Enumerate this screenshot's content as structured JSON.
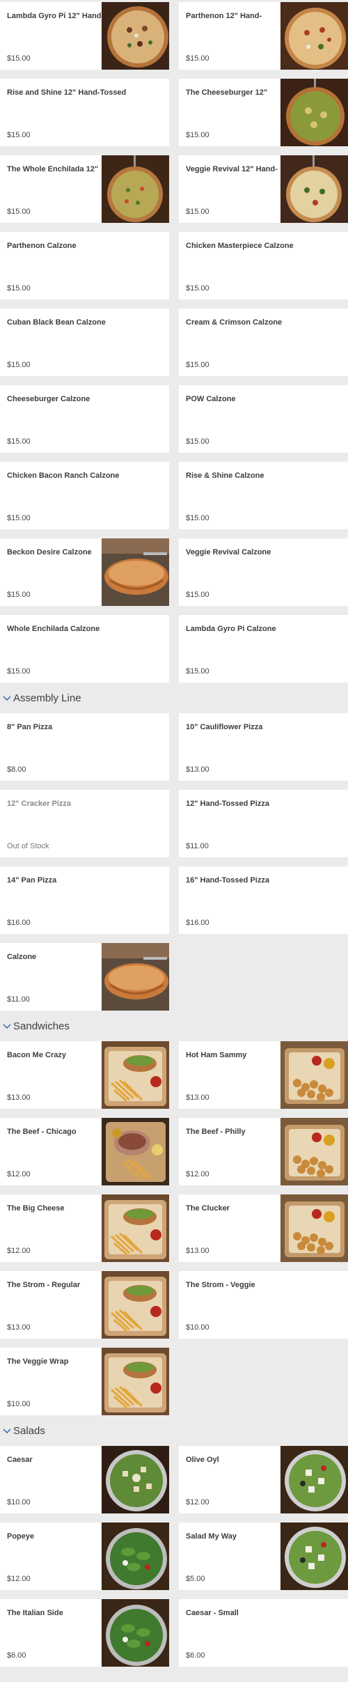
{
  "pizzas": [
    {
      "name": "Lambda Gyro Pi 12\" Hand-",
      "price": "$15.00",
      "img": "pizza-a"
    },
    {
      "name": "Parthenon 12\" Hand-",
      "price": "$15.00",
      "img": "pizza-b"
    },
    {
      "name": "Rise and Shine 12\" Hand-Tossed",
      "price": "$15.00",
      "img": null
    },
    {
      "name": "The Cheeseburger 12\"",
      "price": "$15.00",
      "img": "pizza-c"
    },
    {
      "name": "The Whole Enchilada 12\"",
      "price": "$15.00",
      "img": "pizza-d"
    },
    {
      "name": "Veggie Revival 12\" Hand-",
      "price": "$15.00",
      "img": "pizza-e"
    },
    {
      "name": "Parthenon Calzone",
      "price": "$15.00",
      "img": null
    },
    {
      "name": "Chicken Masterpiece Calzone",
      "price": "$15.00",
      "img": null
    },
    {
      "name": "Cuban Black Bean Calzone",
      "price": "$15.00",
      "img": null
    },
    {
      "name": "Cream & Crimson Calzone",
      "price": "$15.00",
      "img": null
    },
    {
      "name": "Cheeseburger Calzone",
      "price": "$15.00",
      "img": null
    },
    {
      "name": "POW Calzone",
      "price": "$15.00",
      "img": null
    },
    {
      "name": "Chicken Bacon Ranch Calzone",
      "price": "$15.00",
      "img": null
    },
    {
      "name": "Rise & Shine Calzone",
      "price": "$15.00",
      "img": null
    },
    {
      "name": "Beckon Desire Calzone",
      "price": "$15.00",
      "img": "calzone"
    },
    {
      "name": "Veggie Revival Calzone",
      "price": "$15.00",
      "img": null
    },
    {
      "name": "Whole Enchilada Calzone",
      "price": "$15.00",
      "img": null
    },
    {
      "name": "Lambda Gyro Pi Calzone",
      "price": "$15.00",
      "img": null
    }
  ],
  "sections": {
    "assembly": {
      "title": "Assembly Line"
    },
    "sandwiches": {
      "title": "Sandwiches"
    },
    "salads": {
      "title": "Salads"
    }
  },
  "assembly_items": [
    {
      "name": "8\" Pan Pizza",
      "price": "$8.00",
      "img": null
    },
    {
      "name": "10\" Cauliflower Pizza",
      "price": "$13.00",
      "img": null
    },
    {
      "name": "12\" Cracker Pizza",
      "price": "Out of Stock",
      "img": null,
      "oos": true
    },
    {
      "name": "12\" Hand-Tossed Pizza",
      "price": "$11.00",
      "img": null
    },
    {
      "name": "14\" Pan Pizza",
      "price": "$16.00",
      "img": null
    },
    {
      "name": "16\" Hand-Tossed Pizza",
      "price": "$16.00",
      "img": null
    },
    {
      "name": "Calzone",
      "price": "$11.00",
      "img": "calzone"
    }
  ],
  "sandwich_items": [
    {
      "name": "Bacon Me Crazy",
      "price": "$13.00",
      "img": "sandwich"
    },
    {
      "name": "Hot Ham Sammy",
      "price": "$13.00",
      "img": "tots"
    },
    {
      "name": "The Beef - Chicago",
      "price": "$12.00",
      "img": "beef"
    },
    {
      "name": "The Beef - Philly",
      "price": "$12.00",
      "img": "tots"
    },
    {
      "name": "The Big Cheese",
      "price": "$12.00",
      "img": "sandwich"
    },
    {
      "name": "The Clucker",
      "price": "$13.00",
      "img": "tots"
    },
    {
      "name": "The Strom - Regular",
      "price": "$13.00",
      "img": "sandwich"
    },
    {
      "name": "The Strom - Veggie",
      "price": "$10.00",
      "img": null
    },
    {
      "name": "The Veggie Wrap",
      "price": "$10.00",
      "img": "sandwich"
    }
  ],
  "salad_items": [
    {
      "name": "Caesar",
      "price": "$10.00",
      "img": "salad-caesar"
    },
    {
      "name": "Olive Oyl",
      "price": "$12.00",
      "img": "salad-greek"
    },
    {
      "name": "Popeye",
      "price": "$12.00",
      "img": "salad-spinach"
    },
    {
      "name": "Salad My Way",
      "price": "$5.00",
      "img": "salad-greek"
    },
    {
      "name": "The Italian Side",
      "price": "$6.00",
      "img": "salad-spinach"
    },
    {
      "name": "Caesar - Small",
      "price": "$6.00",
      "img": null
    }
  ],
  "colors": {
    "page_bg": "#ebebeb",
    "card_bg": "#ffffff",
    "chevron": "#2f5fb3"
  }
}
